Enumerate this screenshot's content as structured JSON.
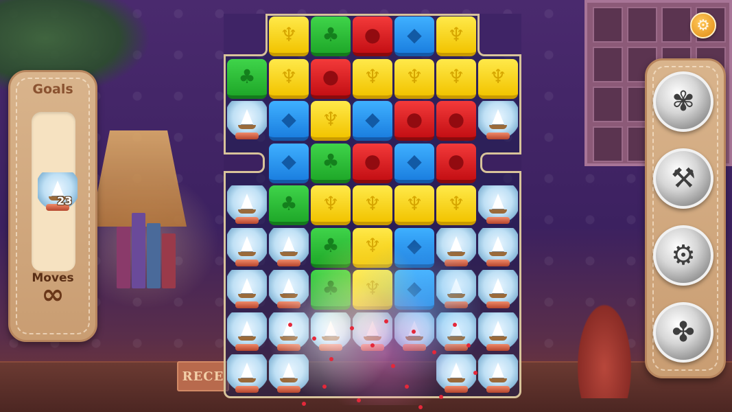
{
  "scene": {
    "sign_text": "RECE"
  },
  "goals": {
    "title": "Goals",
    "items": [
      {
        "icon": "snow-globe-icon",
        "count": "23"
      }
    ],
    "moves_label": "Moves",
    "moves_value": "∞"
  },
  "settings": {
    "icon": "gear-icon",
    "glyph": "⚙"
  },
  "boosters": [
    {
      "icon": "feather-duster-icon",
      "glyph": "✾"
    },
    {
      "icon": "toolbox-icon",
      "glyph": "⚒"
    },
    {
      "icon": "vacuum-icon",
      "glyph": "⚙"
    },
    {
      "icon": "fan-icon",
      "glyph": "✤"
    }
  ],
  "tile_icons": {
    "yellow": "duck-icon",
    "green": "cactus-icon",
    "red": "apple-icon",
    "blue": "whale-icon",
    "globe": "snow-globe-icon"
  },
  "tile_colors": {
    "yellow": "#f2c400",
    "green": "#1fa829",
    "red": "#c40f14",
    "blue": "#1b7fe0"
  },
  "board": {
    "columns": 7,
    "grid": [
      [
        "",
        "yellow",
        "green",
        "red",
        "blue",
        "yellow",
        ""
      ],
      [
        "green",
        "yellow",
        "red",
        "yellow",
        "yellow",
        "yellow",
        "yellow"
      ],
      [
        "globe",
        "blue",
        "yellow",
        "blue",
        "red",
        "red",
        "globe"
      ],
      [
        "",
        "blue",
        "green",
        "red",
        "blue",
        "red",
        ""
      ],
      [
        "globe",
        "green",
        "yellow",
        "yellow",
        "yellow",
        "yellow",
        "globe"
      ],
      [
        "globe",
        "globe",
        "green",
        "yellow",
        "blue",
        "globe",
        "globe"
      ],
      [
        "globe",
        "globe",
        "green",
        "yellow",
        "blue",
        "globe",
        "globe"
      ],
      [
        "globe",
        "globe",
        "globe",
        "globe",
        "globe",
        "globe",
        "globe"
      ],
      [
        "globe",
        "globe",
        "",
        "",
        "",
        "globe",
        "globe"
      ]
    ]
  }
}
